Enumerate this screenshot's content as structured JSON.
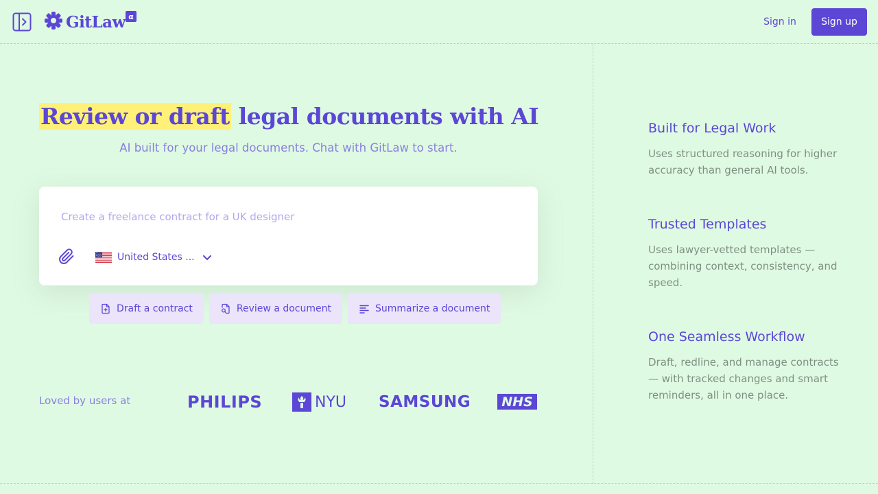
{
  "header": {
    "logo_text": "GitLaw",
    "badge": "α",
    "signin_label": "Sign in",
    "signup_label": "Sign up"
  },
  "hero": {
    "title_highlight": "Review or draft",
    "title_rest": " legal documents with AI",
    "subtitle": "AI built for your legal documents. Chat with GitLaw to start."
  },
  "chat": {
    "placeholder": "Create a freelance contract for a UK designer",
    "value": "",
    "jurisdiction_label": "United States ..."
  },
  "actions": [
    {
      "label": "Draft a contract",
      "icon": "file-plus-icon"
    },
    {
      "label": "Review a document",
      "icon": "file-search-icon"
    },
    {
      "label": "Summarize a document",
      "icon": "align-left-icon"
    }
  ],
  "social_proof": {
    "label": "Loved by users at",
    "brands": [
      "PHILIPS",
      "NYU",
      "SAMSUNG",
      "NHS"
    ]
  },
  "features": [
    {
      "title": "Built for Legal Work",
      "body": "Uses structured reasoning for higher accuracy than general AI tools."
    },
    {
      "title": "Trusted Templates",
      "body": "Uses lawyer-vetted templates — combining context, consistency, and speed."
    },
    {
      "title": "One Seamless Workflow",
      "body": "Draft, redline, and manage contracts — with tracked changes and smart reminders, all in one place."
    }
  ],
  "colors": {
    "background": "#dffae3",
    "accent": "#5b46d6",
    "highlight": "#fff178",
    "action_bg": "#ebe4fb",
    "muted_text": "#7f8f83"
  }
}
